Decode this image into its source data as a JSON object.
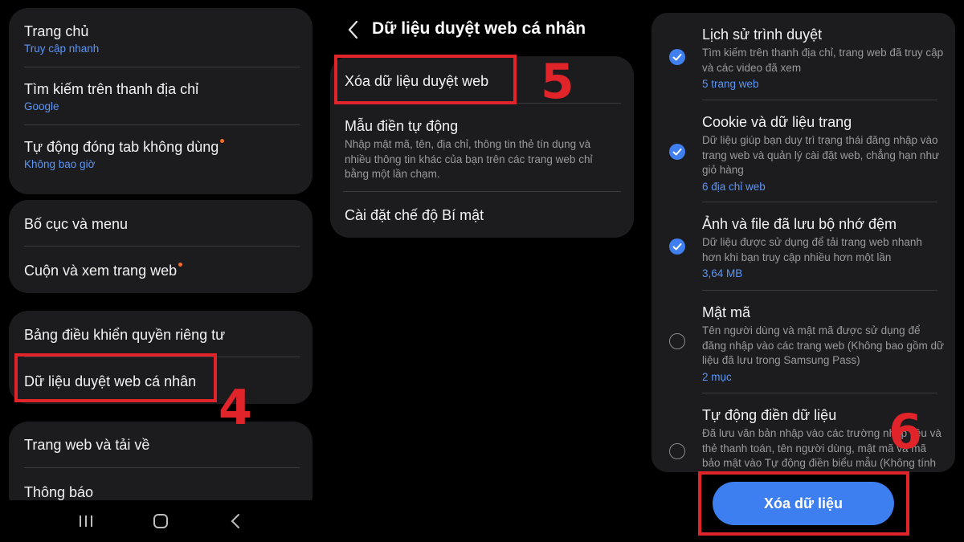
{
  "panel1": {
    "card1": [
      {
        "title": "Trang chủ",
        "sub": "Truy cập nhanh"
      },
      {
        "title": "Tìm kiếm trên thanh địa chỉ",
        "sub": "Google"
      },
      {
        "title": "Tự động đóng tab không dùng",
        "sub": "Không bao giờ"
      }
    ],
    "card2": [
      {
        "title": "Bố cục và menu"
      },
      {
        "title": "Cuộn và xem trang web"
      }
    ],
    "card3": [
      {
        "title": "Bảng điều khiển quyền riêng tư"
      },
      {
        "title": "Dữ liệu duyệt web cá nhân"
      }
    ],
    "card4": [
      {
        "title": "Trang web và tải về"
      },
      {
        "title": "Thông báo"
      }
    ],
    "step": "4"
  },
  "panel2": {
    "title": "Dữ liệu duyệt web cá nhân",
    "items": [
      {
        "title": "Xóa dữ liệu duyệt web"
      },
      {
        "title": "Mẫu điền tự động",
        "desc": "Nhập mật mã, tên, địa chỉ, thông tin thẻ tín dụng và nhiều thông tin khác của bạn trên các trang web chỉ bằng một lần chạm."
      },
      {
        "title": "Cài đặt chế độ Bí mật"
      }
    ],
    "step": "5"
  },
  "panel3": {
    "items": [
      {
        "title": "Lịch sử trình duyệt",
        "desc": "Tìm kiếm trên thanh địa chỉ, trang web đã truy cập và các video đã xem",
        "sub": "5 trang web",
        "checked": true
      },
      {
        "title": "Cookie và dữ liệu trang",
        "desc": "Dữ liệu giúp bạn duy trì trạng thái đăng nhập vào trang web và quản lý cài đặt web, chẳng hạn như giỏ hàng",
        "sub": "6 địa chỉ web",
        "checked": true
      },
      {
        "title": "Ảnh và file đã lưu bộ nhớ đệm",
        "desc": "Dữ liệu được sử dụng để tải trang web nhanh hơn khi bạn truy cập nhiều hơn một lần",
        "sub": "3,64 MB",
        "checked": true
      },
      {
        "title": "Mật mã",
        "desc": "Tên người dùng và mật mã được sử dụng để đăng nhập vào các trang web (Không bao gồm dữ liệu đã lưu trong Samsung Pass)",
        "sub": "2 mục",
        "checked": false
      },
      {
        "title": "Tự động điền dữ liệu",
        "desc": "Đã lưu văn bản nhập vào các trường nhập liệu và thẻ thanh toán, tên người dùng, mật mã và mã bảo mật vào Tự động điền biểu mẫu (Không tính dữ liệu",
        "checked": false
      }
    ],
    "button": "Xóa dữ liệu",
    "step": "6"
  },
  "colors": {
    "background": "#000000",
    "card": "#1c1c1e",
    "accent_blue": "#3d7ef0",
    "subtext_blue": "#5c95f5",
    "annotation_red": "#e0242a",
    "notification_dot": "#f36b2b"
  },
  "icons": {
    "nav": [
      "recent-apps-icon",
      "home-icon",
      "back-icon"
    ],
    "header": "chevron-left-icon",
    "check": "checkmark-icon"
  }
}
